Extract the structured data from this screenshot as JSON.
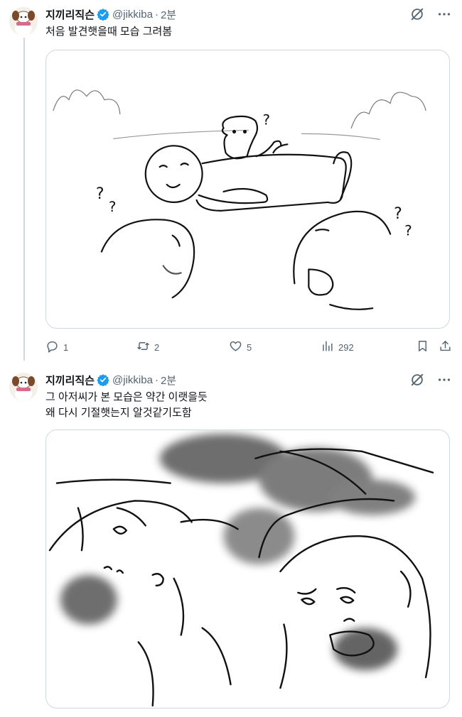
{
  "tweets": [
    {
      "name": "지끼리직슨",
      "handle": "@jikkiba",
      "separator": "·",
      "time": "2분",
      "text": "처음 발견햇을때 모습 그려봄",
      "stats": {
        "replies": "1",
        "retweets": "2",
        "likes": "5",
        "views": "292"
      }
    },
    {
      "name": "지끼리직슨",
      "handle": "@jikkiba",
      "separator": "·",
      "time": "2분",
      "text": "그 아저씨가 본 모습은 약간 이랫을듯\n왜 다시 기절햇는지 알것같기도함"
    }
  ],
  "icons": {
    "verified": "verified-badge-icon",
    "grok": "grok-icon",
    "more": "more-icon",
    "reply": "reply-icon",
    "retweet": "retweet-icon",
    "like": "heart-icon",
    "views": "views-icon",
    "bookmark": "bookmark-icon",
    "share": "share-icon"
  },
  "colors": {
    "text": "#0f1419",
    "secondary": "#536471",
    "border": "#cfd9de",
    "verified": "#1d9bf0"
  }
}
